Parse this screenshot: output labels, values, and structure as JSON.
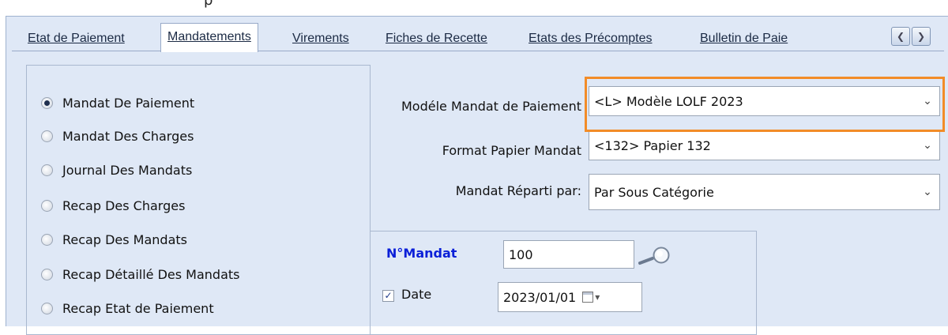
{
  "window": {
    "top_text": "p"
  },
  "tabs": [
    {
      "label": "Etat de Paiement"
    },
    {
      "label": "Mandatements"
    },
    {
      "label": "Virements"
    },
    {
      "label": "Fiches de Recette"
    },
    {
      "label": "Etats des Précomptes"
    },
    {
      "label": "Bulletin de Paie"
    }
  ],
  "active_tab": "Mandatements",
  "report_options": [
    {
      "label": "Mandat De Paiement",
      "selected": true
    },
    {
      "label": "Mandat Des Charges",
      "selected": false
    },
    {
      "label": "Journal Des Mandats",
      "selected": false
    },
    {
      "label": "Recap Des Charges",
      "selected": false
    },
    {
      "label": "Recap Des Mandats",
      "selected": false
    },
    {
      "label": "Recap Détaillé Des Mandats",
      "selected": false
    },
    {
      "label": "Recap Etat de Paiement",
      "selected": false
    }
  ],
  "form": {
    "modele": {
      "label": "Modéle Mandat de Paiement",
      "value": "<L> Modèle LOLF 2023"
    },
    "format": {
      "label": "Format Papier Mandat",
      "value": "<132> Papier 132"
    },
    "reparti": {
      "label": "Mandat Réparti par:",
      "value": "Par Sous Catégorie"
    },
    "num_mandat": {
      "label": "N°Mandat",
      "value": "100"
    },
    "date": {
      "label": "Date",
      "value": "2023/01/01",
      "checked": true
    }
  },
  "icons": {
    "nav_prev": "chevron-left-icon",
    "nav_next": "chevron-right-icon",
    "search": "magnifier-icon",
    "calendar": "calendar-icon"
  },
  "colors": {
    "highlight": "#f28c28",
    "mandat_label": "#0a1fd8",
    "panel_bg": "#dfe8f6"
  }
}
